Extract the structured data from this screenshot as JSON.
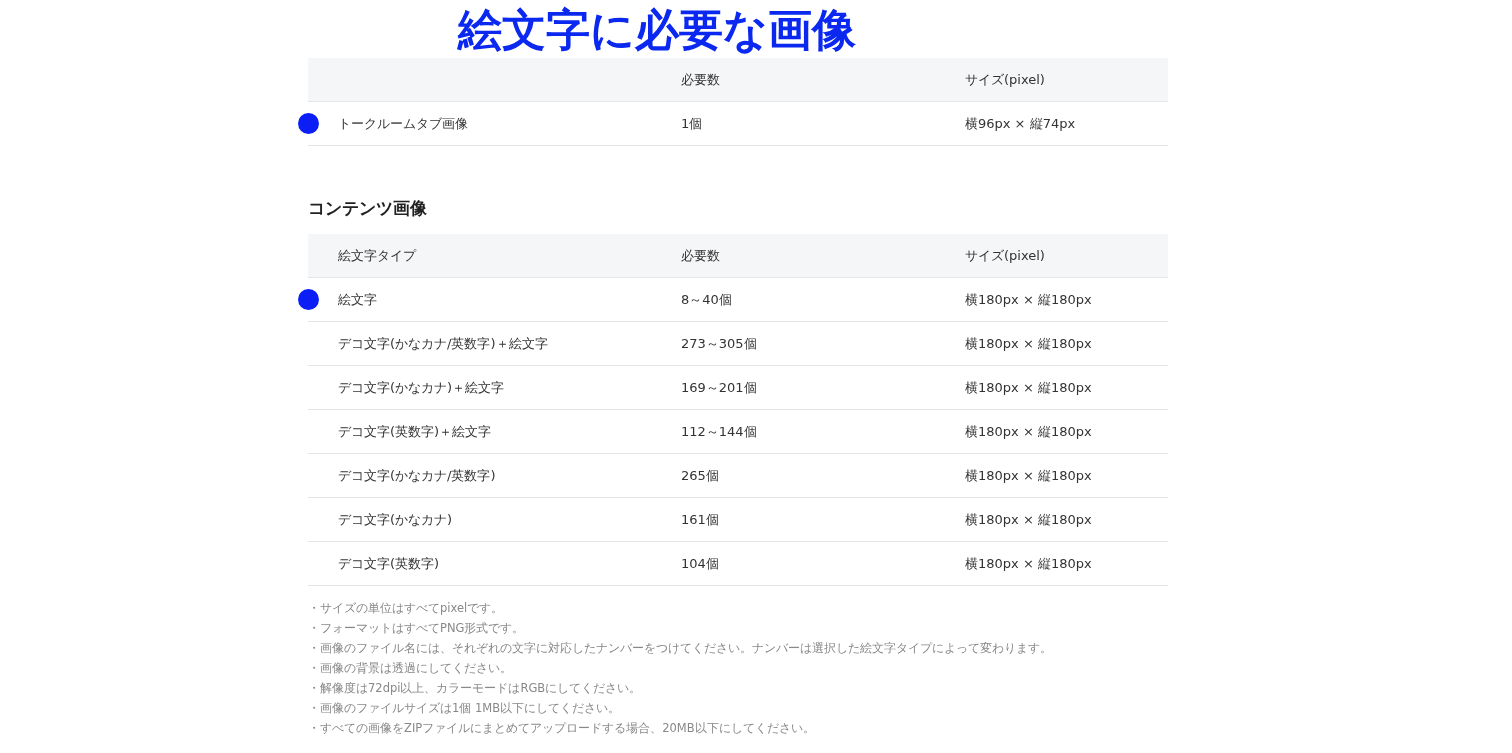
{
  "title": "絵文字に必要な画像",
  "tab_image_table": {
    "columns": [
      "",
      "必要数",
      "サイズ(pixel)"
    ],
    "rows": [
      {
        "cells": [
          "トークルームタブ画像",
          "1個",
          "横96px × 縦74px"
        ],
        "marked": true
      }
    ]
  },
  "content_section": {
    "heading": "コンテンツ画像",
    "table": {
      "columns": [
        "絵文字タイプ",
        "必要数",
        "サイズ(pixel)"
      ],
      "rows": [
        {
          "cells": [
            "絵文字",
            "8～40個",
            "横180px × 縦180px"
          ],
          "marked": true
        },
        {
          "cells": [
            "デコ文字(かなカナ/英数字)＋絵文字",
            "273～305個",
            "横180px × 縦180px"
          ],
          "marked": false
        },
        {
          "cells": [
            "デコ文字(かなカナ)＋絵文字",
            "169～201個",
            "横180px × 縦180px"
          ],
          "marked": false
        },
        {
          "cells": [
            "デコ文字(英数字)＋絵文字",
            "112～144個",
            "横180px × 縦180px"
          ],
          "marked": false
        },
        {
          "cells": [
            "デコ文字(かなカナ/英数字)",
            "265個",
            "横180px × 縦180px"
          ],
          "marked": false
        },
        {
          "cells": [
            "デコ文字(かなカナ)",
            "161個",
            "横180px × 縦180px"
          ],
          "marked": false
        },
        {
          "cells": [
            "デコ文字(英数字)",
            "104個",
            "横180px × 縦180px"
          ],
          "marked": false
        }
      ]
    }
  },
  "notes": [
    "・サイズの単位はすべてpixelです。",
    "・フォーマットはすべてPNG形式です。",
    "・画像のファイル名には、それぞれの文字に対応したナンバーをつけてください。ナンバーは選択した絵文字タイプによって変わります。",
    "・画像の背景は透過にしてください。",
    "・解像度は72dpi以上、カラーモードはRGBにしてください。",
    "・画像のファイルサイズは1個 1MB以下にしてください。",
    "・すべての画像をZIPファイルにまとめてアップロードする場合、20MB以下にしてください。"
  ]
}
